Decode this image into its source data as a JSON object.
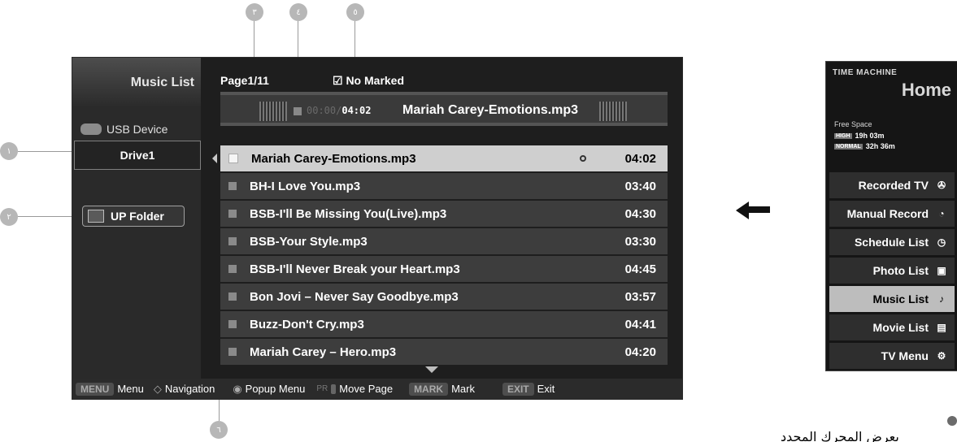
{
  "callouts": {
    "c1": "١",
    "c2": "٢",
    "c3": "٣",
    "c4": "٤",
    "c5": "٥",
    "c6": "٦"
  },
  "music_screen": {
    "title": "Music List",
    "usb_label": "USB Device",
    "drive_label": "Drive1",
    "upfolder_label": "UP Folder",
    "page_label": "Page1/11",
    "marked_label": "☑ No Marked",
    "player": {
      "elapsed": "00:00/",
      "total": "04:02",
      "song": "Mariah Carey-Emotions.mp3"
    },
    "playlist": [
      {
        "name": "Mariah Carey-Emotions.mp3",
        "duration": "04:02",
        "selected": true
      },
      {
        "name": "BH-I Love You.mp3",
        "duration": "03:40",
        "selected": false
      },
      {
        "name": "BSB-I'll Be Missing You(Live).mp3",
        "duration": "04:30",
        "selected": false
      },
      {
        "name": "BSB-Your Style.mp3",
        "duration": "03:30",
        "selected": false
      },
      {
        "name": "BSB-I'll Never Break your Heart.mp3",
        "duration": "04:45",
        "selected": false
      },
      {
        "name": "Bon Jovi – Never Say Goodbye.mp3",
        "duration": "03:57",
        "selected": false
      },
      {
        "name": "Buzz-Don't Cry.mp3",
        "duration": "04:41",
        "selected": false
      },
      {
        "name": "Mariah Carey – Hero.mp3",
        "duration": "04:20",
        "selected": false
      }
    ],
    "bottom_bar": {
      "menu_key": "MENU",
      "menu_label": "Menu",
      "nav_label": "Navigation",
      "popup_label": "Popup Menu",
      "page_key": "PR",
      "movepage_label": "Move Page",
      "mark_key": "MARK",
      "mark_label": "Mark",
      "exit_key": "EXIT",
      "exit_label": "Exit"
    }
  },
  "tm_panel": {
    "title": "TIME MACHINE",
    "home": "Home",
    "free_space_label": "Free Space",
    "high_tag": "HIGH",
    "high_value": "19h 03m",
    "normal_tag": "NORMAL",
    "normal_value": "32h 36m",
    "menu": [
      {
        "label": "Recorded TV",
        "icon": "film-reel-icon",
        "active": false
      },
      {
        "label": "Manual Record",
        "icon": "timer-record-icon",
        "active": false
      },
      {
        "label": "Schedule List",
        "icon": "schedule-clock-icon",
        "active": false
      },
      {
        "label": "Photo List",
        "icon": "photo-icon",
        "active": false
      },
      {
        "label": "Music List",
        "icon": "music-note-icon",
        "active": true
      },
      {
        "label": "Movie List",
        "icon": "movie-icon",
        "active": false
      },
      {
        "label": "TV Menu",
        "icon": "gear-icon",
        "active": false
      }
    ]
  },
  "caption": "يعرض المحرك المحدد"
}
